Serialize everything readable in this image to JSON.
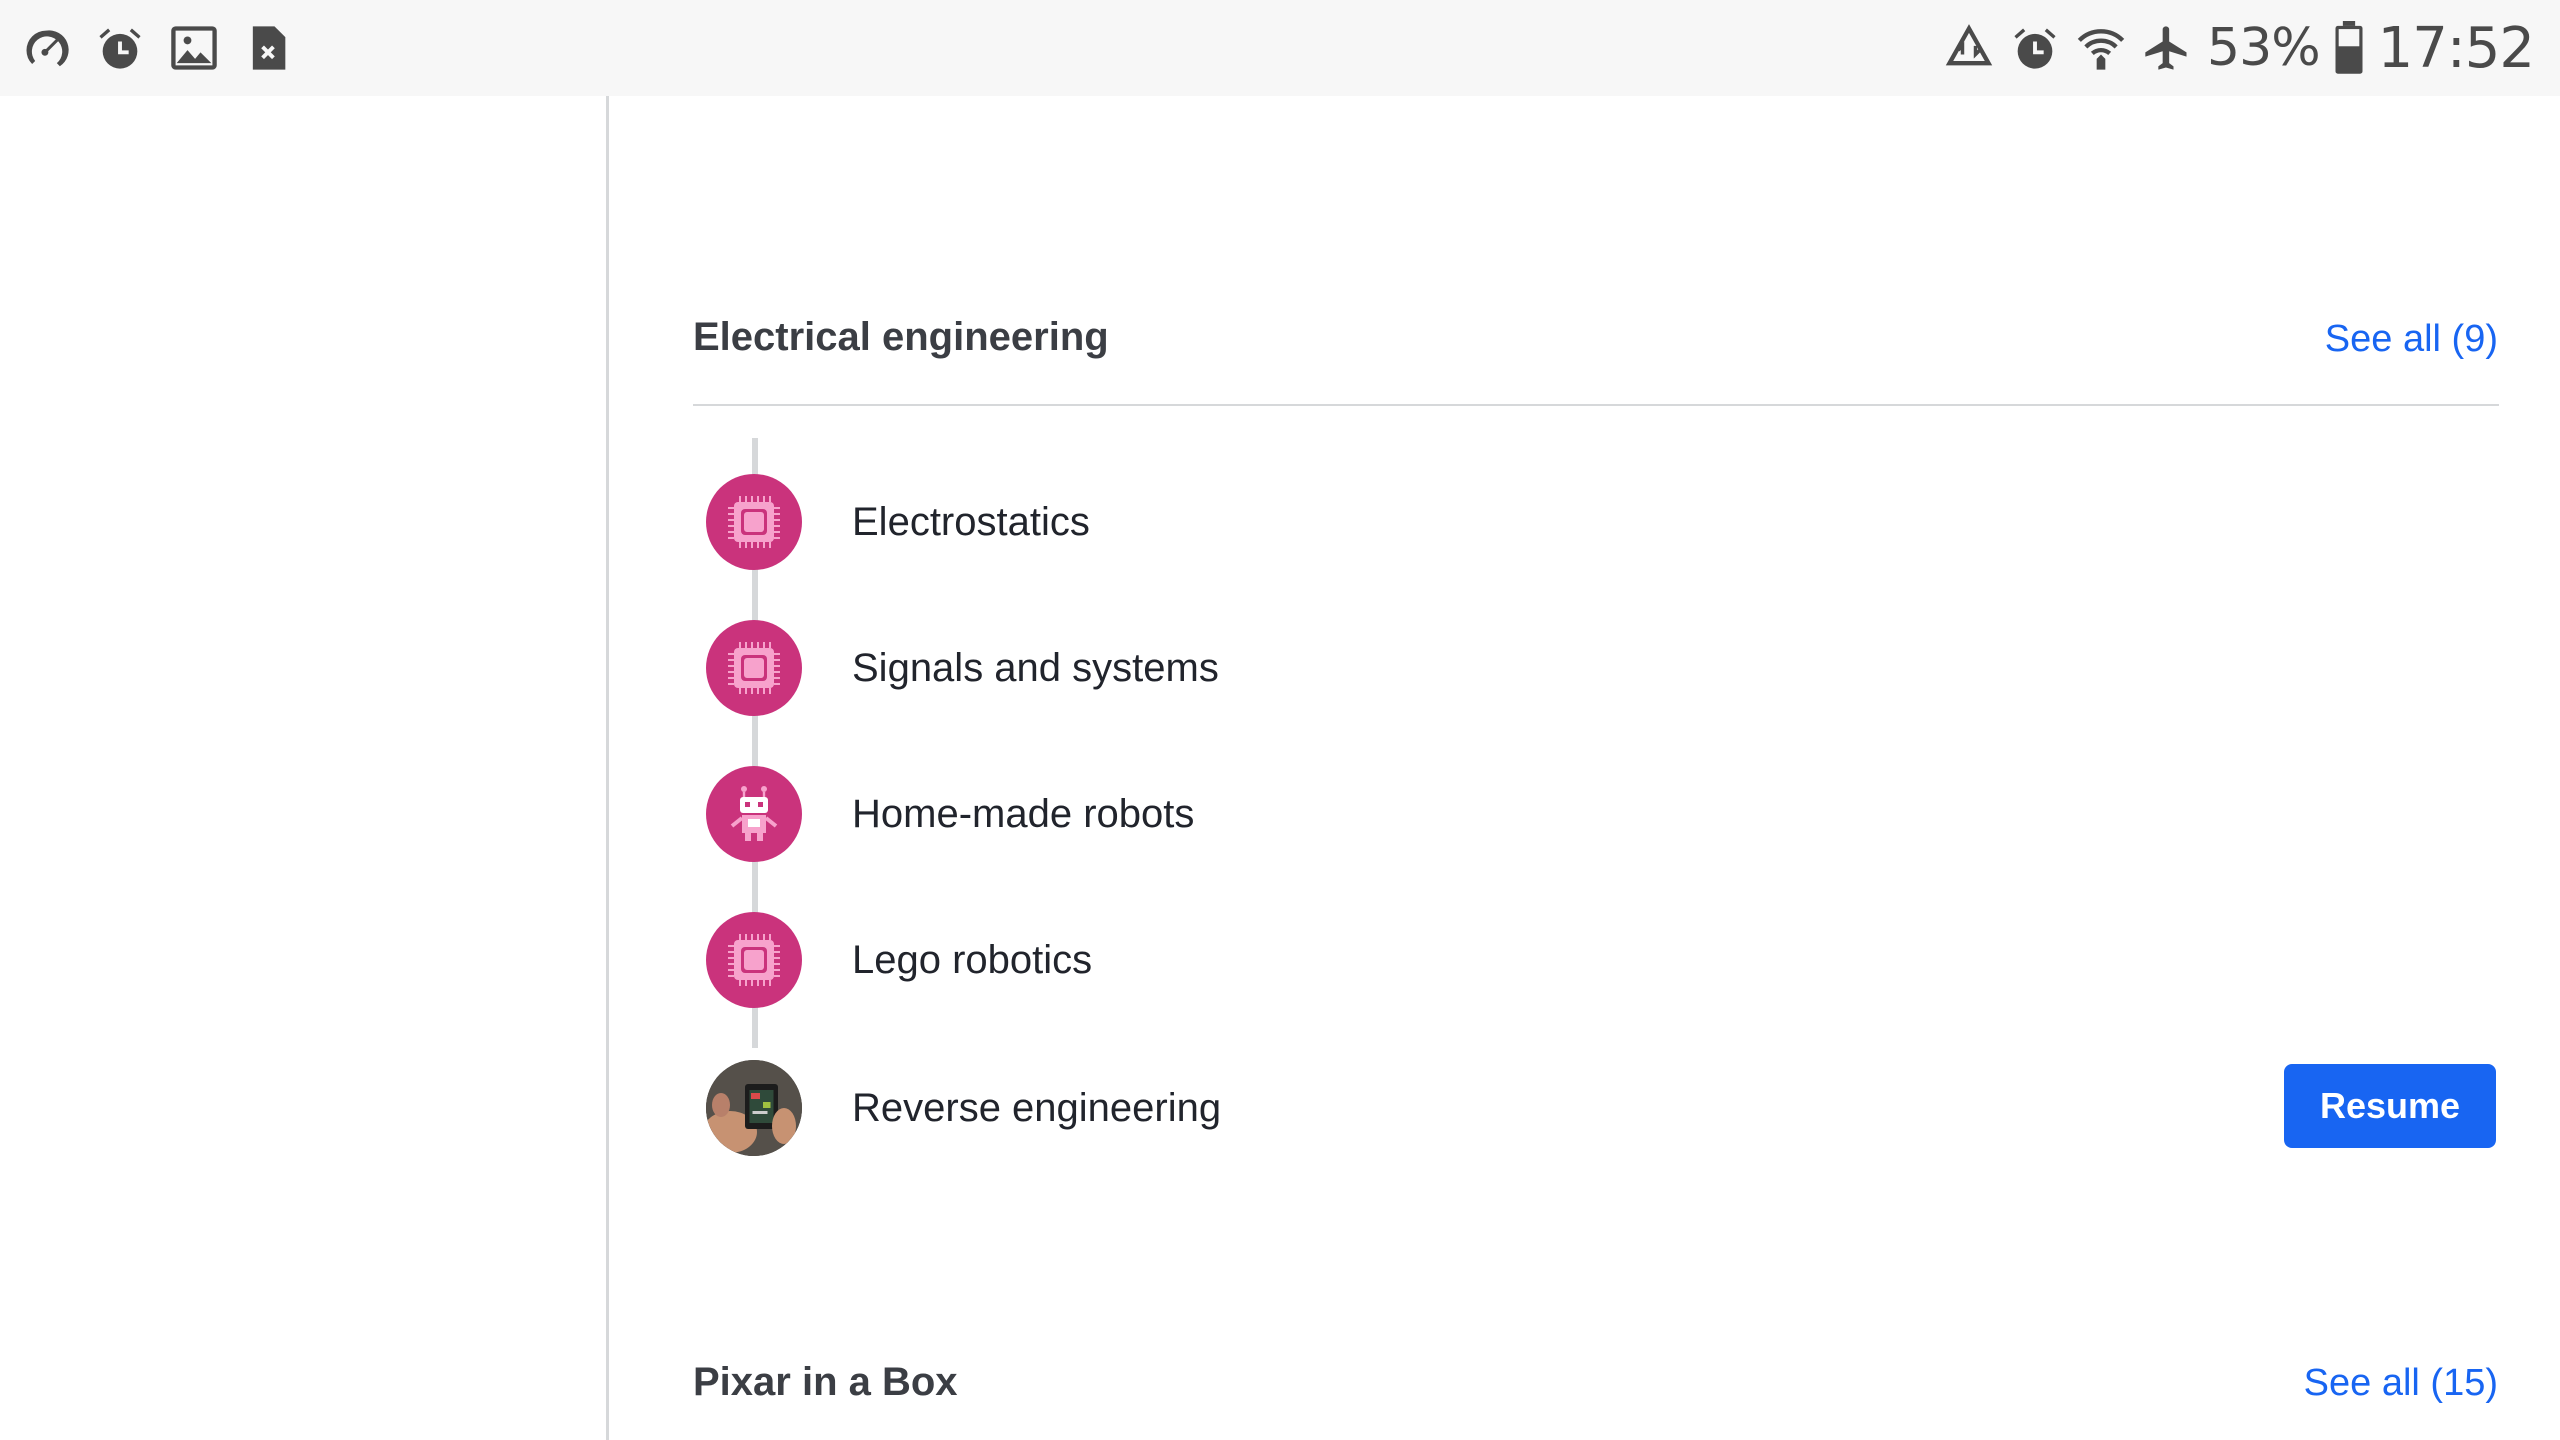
{
  "status_bar": {
    "left_icons": [
      "speedometer-icon",
      "alarm-icon",
      "image-icon",
      "sim-error-icon"
    ],
    "right_icons": [
      "data-saver-icon",
      "alarm-icon",
      "wifi-icon",
      "airplane-mode-icon"
    ],
    "battery_percent": "53%",
    "time": "17:52"
  },
  "sections": [
    {
      "title": "Electrical engineering",
      "see_all": "See all (9)",
      "topics": [
        {
          "label": "Electrostatics",
          "icon": "chip-icon"
        },
        {
          "label": "Signals and systems",
          "icon": "chip-icon"
        },
        {
          "label": "Home-made robots",
          "icon": "robot-icon"
        },
        {
          "label": "Lego robotics",
          "icon": "chip-icon"
        },
        {
          "label": "Reverse engineering",
          "icon": "circuit-board-photo",
          "action": "Resume"
        }
      ]
    },
    {
      "title": "Pixar in a Box",
      "see_all": "See all (15)"
    }
  ],
  "colors": {
    "accent": "#1865f2",
    "topic_icon_bg": "#ca337c",
    "divider": "#d6d8da"
  }
}
